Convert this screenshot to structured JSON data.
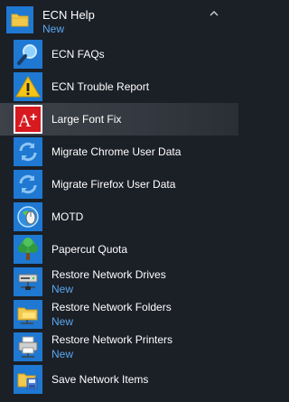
{
  "group": {
    "title": "ECN Help",
    "badge": "New",
    "icon": "folder-icon",
    "collapse_icon": "chevron-up-icon"
  },
  "colors": {
    "background": "#1b1f26",
    "tile": "#1f78d1",
    "new_badge": "#5aa8ef",
    "text": "#ffffff"
  },
  "items": [
    {
      "label": "ECN FAQs",
      "icon": "magnifier-icon"
    },
    {
      "label": "ECN Trouble Report",
      "icon": "warning-icon"
    },
    {
      "label": "Large Font Fix",
      "icon": "font-plus-icon",
      "selected": true
    },
    {
      "label": "Migrate Chrome User Data",
      "icon": "sync-icon"
    },
    {
      "label": "Migrate Firefox User Data",
      "icon": "sync-icon"
    },
    {
      "label": "MOTD",
      "icon": "globe-mouse-icon"
    },
    {
      "label": "Papercut Quota",
      "icon": "tree-icon"
    },
    {
      "label": "Restore Network Drives",
      "badge": "New",
      "icon": "network-drive-icon"
    },
    {
      "label": "Restore Network Folders",
      "badge": "New",
      "icon": "network-folder-icon"
    },
    {
      "label": "Restore Network Printers",
      "badge": "New",
      "icon": "printer-icon"
    },
    {
      "label": "Save Network Items",
      "icon": "save-folder-icon"
    }
  ]
}
